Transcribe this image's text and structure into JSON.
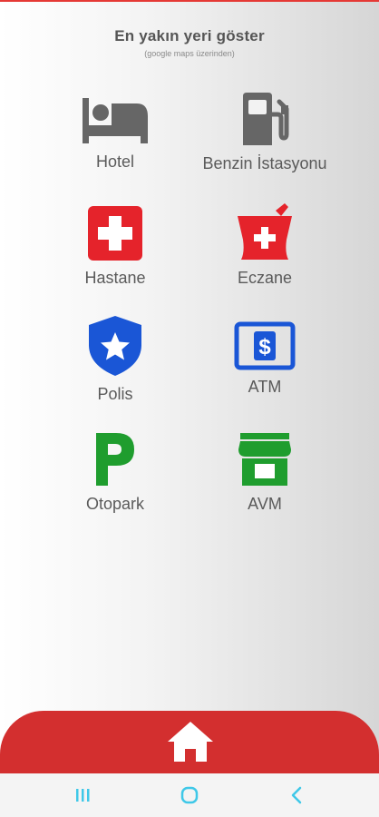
{
  "header": {
    "title": "En yakın yeri göster",
    "subtitle": "(google maps üzerinden)"
  },
  "places": [
    {
      "label": "Hotel",
      "icon": "bed-icon",
      "color": "#666666"
    },
    {
      "label": "Benzin İstasyonu",
      "icon": "fuel-pump-icon",
      "color": "#666666"
    },
    {
      "label": "Hastane",
      "icon": "hospital-cross-icon",
      "color": "#e5232b"
    },
    {
      "label": "Eczane",
      "icon": "pharmacy-mortar-icon",
      "color": "#e5232b"
    },
    {
      "label": "Polis",
      "icon": "police-shield-icon",
      "color": "#1a56d6"
    },
    {
      "label": "ATM",
      "icon": "atm-dollar-icon",
      "color": "#1a56d6"
    },
    {
      "label": "Otopark",
      "icon": "parking-p-icon",
      "color": "#1f9d2e"
    },
    {
      "label": "AVM",
      "icon": "shopping-store-icon",
      "color": "#1f9d2e"
    }
  ],
  "bottom": {
    "icon": "home-icon",
    "bar_color": "#d32f2f"
  },
  "navbar": {
    "icons": [
      "recent-apps-icon",
      "home-circle-icon",
      "back-chevron-icon"
    ],
    "color": "#3fc8e8"
  }
}
